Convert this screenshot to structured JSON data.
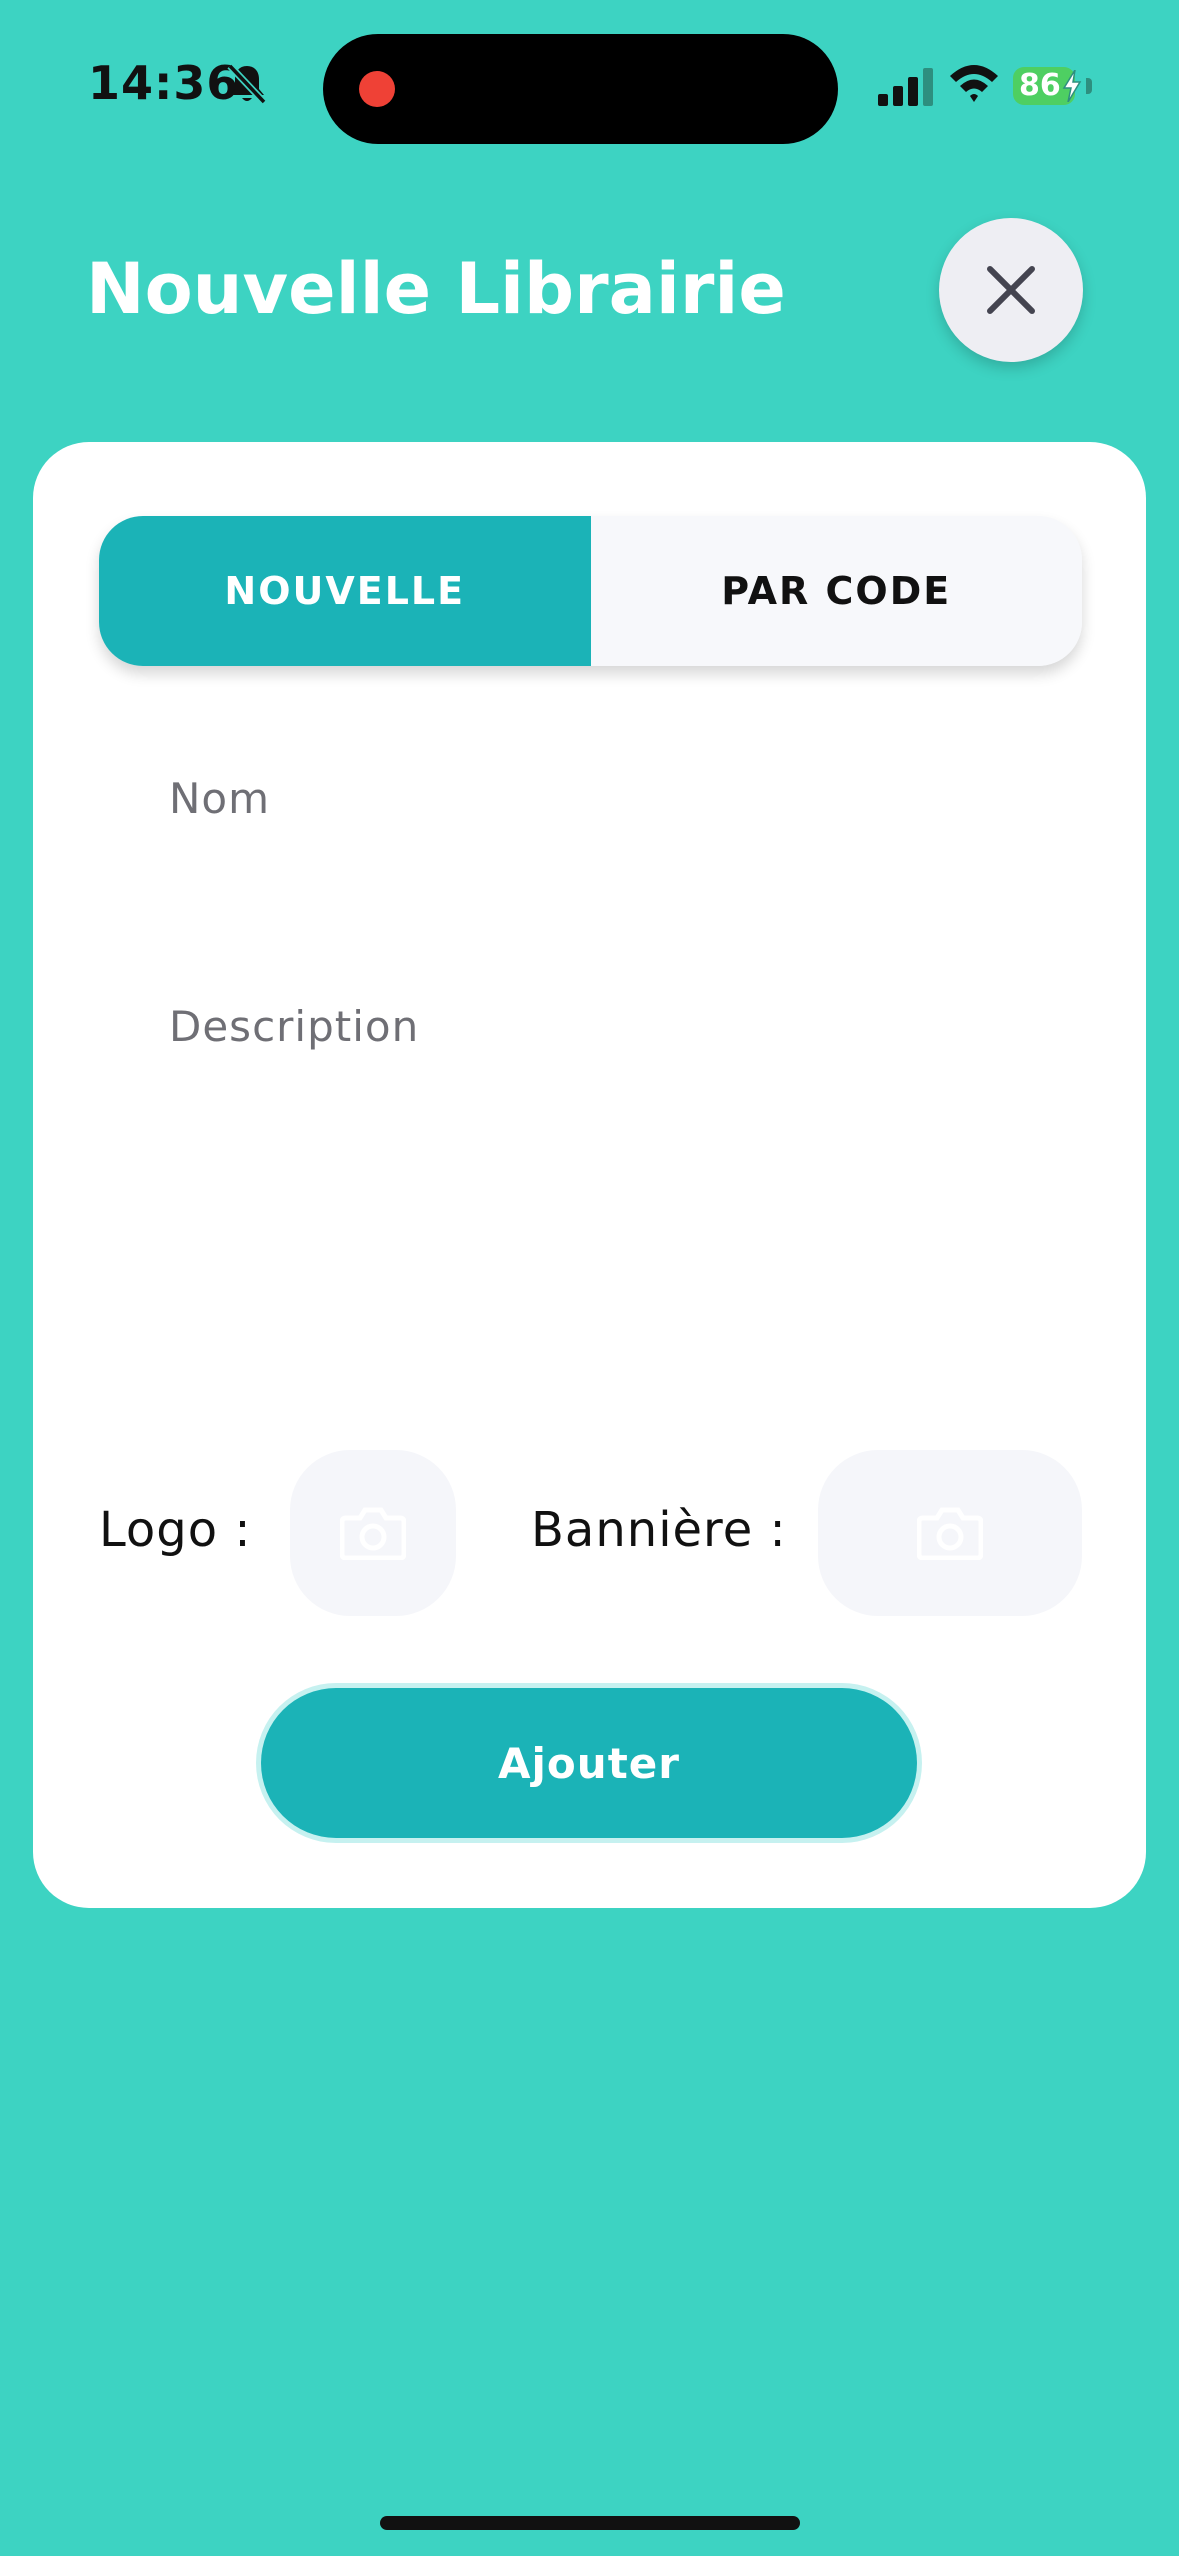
{
  "status_bar": {
    "time": "14:36",
    "battery_level": "86",
    "icons": [
      "bell-off-icon",
      "record-dot-icon",
      "signal-icon",
      "wifi-icon",
      "battery-icon",
      "charging-bolt-icon"
    ]
  },
  "header": {
    "title": "Nouvelle Librairie",
    "close_icon": "close-icon"
  },
  "tabs": [
    {
      "label": "NOUVELLE",
      "active": true
    },
    {
      "label": "PAR CODE",
      "active": false
    }
  ],
  "form": {
    "name_placeholder": "Nom",
    "name_value": "",
    "description_placeholder": "Description",
    "description_value": "",
    "logo_label": "Logo :",
    "banner_label": "Bannière :",
    "picker_icon": "camera-icon",
    "submit_label": "Ajouter"
  },
  "colors": {
    "background": "#3dd3c2",
    "accent": "#1bb3b7",
    "card": "#ffffff",
    "recording": "#ef4136",
    "battery": "#4ecf62"
  }
}
